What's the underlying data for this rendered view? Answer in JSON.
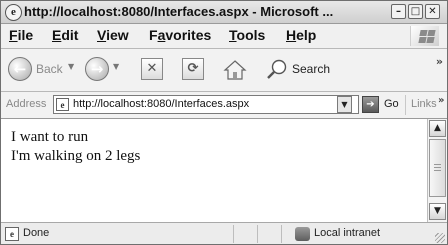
{
  "window": {
    "title": "http://localhost:8080/Interfaces.aspx - Microsoft ...",
    "title_icon_glyph": "e",
    "minimize_glyph": "–",
    "maximize_glyph": "□",
    "close_glyph": "✕"
  },
  "menu": {
    "items": [
      {
        "key": "F",
        "rest": "ile"
      },
      {
        "key": "E",
        "rest": "dit"
      },
      {
        "key": "V",
        "rest": "iew"
      },
      {
        "key": "",
        "pre": "F",
        "key2": "a",
        "rest": "vorites"
      },
      {
        "key": "T",
        "rest": "ools"
      },
      {
        "key": "H",
        "rest": "elp"
      }
    ]
  },
  "toolbar": {
    "back_label": "Back",
    "back_glyph": "←",
    "forward_glyph": "→",
    "dropdown_glyph": "▼",
    "stop_glyph": "✕",
    "refresh_glyph": "⟳",
    "search_label": "Search",
    "overflow_glyph": "»"
  },
  "address": {
    "label": "Address",
    "page_icon_glyph": "e",
    "url": "http://localhost:8080/Interfaces.aspx",
    "dropdown_glyph": "▼",
    "go_glyph": "➔",
    "go_label": "Go",
    "links_label": "Links",
    "links_overflow_glyph": "»"
  },
  "content": {
    "lines": [
      "I want to run",
      "I'm walking on 2 legs"
    ]
  },
  "scrollbar": {
    "up_glyph": "▲",
    "down_glyph": "▼"
  },
  "status": {
    "icon_glyph": "e",
    "text": "Done",
    "zone": "Local intranet"
  },
  "colors": {
    "chrome": "#ece9d8",
    "content_bg": "#ffffff",
    "text": "#111111"
  }
}
